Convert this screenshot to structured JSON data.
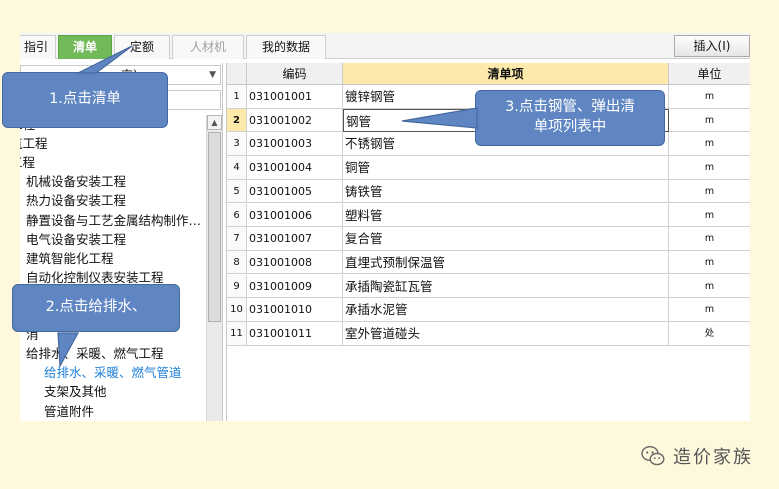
{
  "tabs": [
    {
      "label": "指引",
      "state": "normal"
    },
    {
      "label": "清单",
      "state": "active"
    },
    {
      "label": "定额",
      "state": "normal"
    },
    {
      "label": "人材机",
      "state": "disabled"
    },
    {
      "label": "我的数据",
      "state": "normal"
    }
  ],
  "toolbar": {
    "insert_label": "插入(I)"
  },
  "left_panel": {
    "library_select_value": "京)"
  },
  "tree": {
    "items": [
      {
        "label": "工程",
        "indent": 0
      },
      {
        "label": "筑工程",
        "indent": 0
      },
      {
        "label": "工程",
        "indent": 0
      },
      {
        "label": "机械设备安装工程",
        "indent": 1
      },
      {
        "label": "热力设备安装工程",
        "indent": 1
      },
      {
        "label": "静置设备与工艺金属结构制作…",
        "indent": 1
      },
      {
        "label": "电气设备安装工程",
        "indent": 1
      },
      {
        "label": "建筑智能化工程",
        "indent": 1
      },
      {
        "label": "自动化控制仪表安装工程",
        "indent": 1
      },
      {
        "label": "",
        "indent": 1
      },
      {
        "label": "",
        "indent": 1
      },
      {
        "label": "消",
        "indent": 1
      },
      {
        "label": "给排水、采暖、燃气工程",
        "indent": 1
      },
      {
        "label": "给排水、采暖、燃气管道",
        "indent": 2,
        "selected": true
      },
      {
        "label": "支架及其他",
        "indent": 2
      },
      {
        "label": "管道附件",
        "indent": 2
      }
    ]
  },
  "grid": {
    "headers": {
      "code": "编码",
      "name": "清单项",
      "unit": "单位"
    },
    "rows": [
      {
        "num": "1",
        "code": "031001001",
        "name": "镀锌钢管",
        "unit": "m"
      },
      {
        "num": "2",
        "code": "031001002",
        "name": "钢管",
        "unit": "m",
        "selected": true
      },
      {
        "num": "3",
        "code": "031001003",
        "name": "不锈钢管",
        "unit": "m"
      },
      {
        "num": "4",
        "code": "031001004",
        "name": "铜管",
        "unit": "m"
      },
      {
        "num": "5",
        "code": "031001005",
        "name": "铸铁管",
        "unit": "m"
      },
      {
        "num": "6",
        "code": "031001006",
        "name": "塑料管",
        "unit": "m"
      },
      {
        "num": "7",
        "code": "031001007",
        "name": "复合管",
        "unit": "m"
      },
      {
        "num": "8",
        "code": "031001008",
        "name": "直埋式预制保温管",
        "unit": "m"
      },
      {
        "num": "9",
        "code": "031001009",
        "name": "承插陶瓷缸瓦管",
        "unit": "m"
      },
      {
        "num": "10",
        "code": "031001010",
        "name": "承插水泥管",
        "unit": "m"
      },
      {
        "num": "11",
        "code": "031001011",
        "name": "室外管道碰头",
        "unit": "处"
      }
    ]
  },
  "callouts": {
    "step1": "1.点击清单",
    "step2": "2.点击给排水、",
    "step3": "3.点击钢管、弹出清单项列表中"
  },
  "watermark": {
    "text": "造价家族",
    "icon": "wechat-icon"
  },
  "colors": {
    "active_tab": "#72b95a",
    "callout": "#5f86c2",
    "header_highlight": "#fde9a9",
    "selected_tree_item": "#1e7fd8",
    "background": "#fef9dc"
  }
}
